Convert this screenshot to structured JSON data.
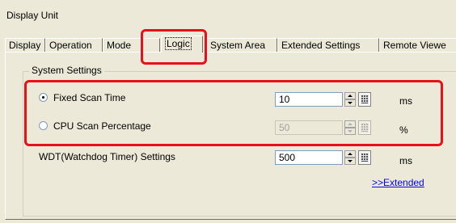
{
  "window": {
    "title": "Display Unit"
  },
  "tabs": [
    {
      "label": "Display"
    },
    {
      "label": "Operation"
    },
    {
      "label": "Mode"
    },
    {
      "label": "Logic",
      "active": true
    },
    {
      "label": "System Area"
    },
    {
      "label": "Extended Settings"
    },
    {
      "label": "Remote Viewe"
    }
  ],
  "system_settings": {
    "group_label": "System Settings",
    "rows": [
      {
        "label": "Fixed Scan Time",
        "selected": true,
        "value": "10",
        "unit": "ms",
        "enabled": true
      },
      {
        "label": "CPU Scan Percentage",
        "selected": false,
        "value": "50",
        "unit": "%",
        "enabled": false
      }
    ],
    "wdt": {
      "label": "WDT(Watchdog Timer) Settings",
      "value": "500",
      "unit": "ms"
    },
    "extended_link": ">>Extended"
  },
  "annotation_color": "#e8101a",
  "icons": [
    "spin-button-icon",
    "keypad-icon",
    "radio-selected-icon",
    "radio-unselected-icon"
  ]
}
